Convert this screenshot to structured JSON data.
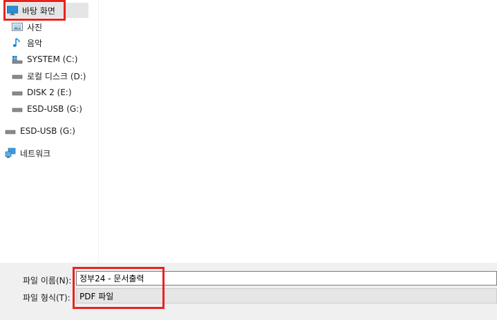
{
  "sidebar": {
    "items": [
      {
        "label": "바탕 화면",
        "icon": "desktop-icon"
      },
      {
        "label": "사진",
        "icon": "pictures-icon"
      },
      {
        "label": "음악",
        "icon": "music-icon"
      },
      {
        "label": "SYSTEM (C:)",
        "icon": "system-drive-icon"
      },
      {
        "label": "로컬 디스크 (D:)",
        "icon": "drive-icon"
      },
      {
        "label": "DISK 2 (E:)",
        "icon": "drive-icon"
      },
      {
        "label": "ESD-USB (G:)",
        "icon": "drive-icon"
      },
      {
        "label": "ESD-USB (G:)",
        "icon": "drive-icon"
      },
      {
        "label": "네트워크",
        "icon": "network-icon"
      }
    ],
    "selected_item": "바탕 화면"
  },
  "bottom": {
    "filename_label": "파일 이름(N):",
    "filename_value": "정부24 - 문서출력",
    "filetype_label": "파일 형식(T):",
    "filetype_value": "PDF 파일"
  },
  "colors": {
    "highlight": "#e8231c",
    "selected_bg": "#e5e5e5",
    "panel_bg": "#f0f0f0"
  }
}
